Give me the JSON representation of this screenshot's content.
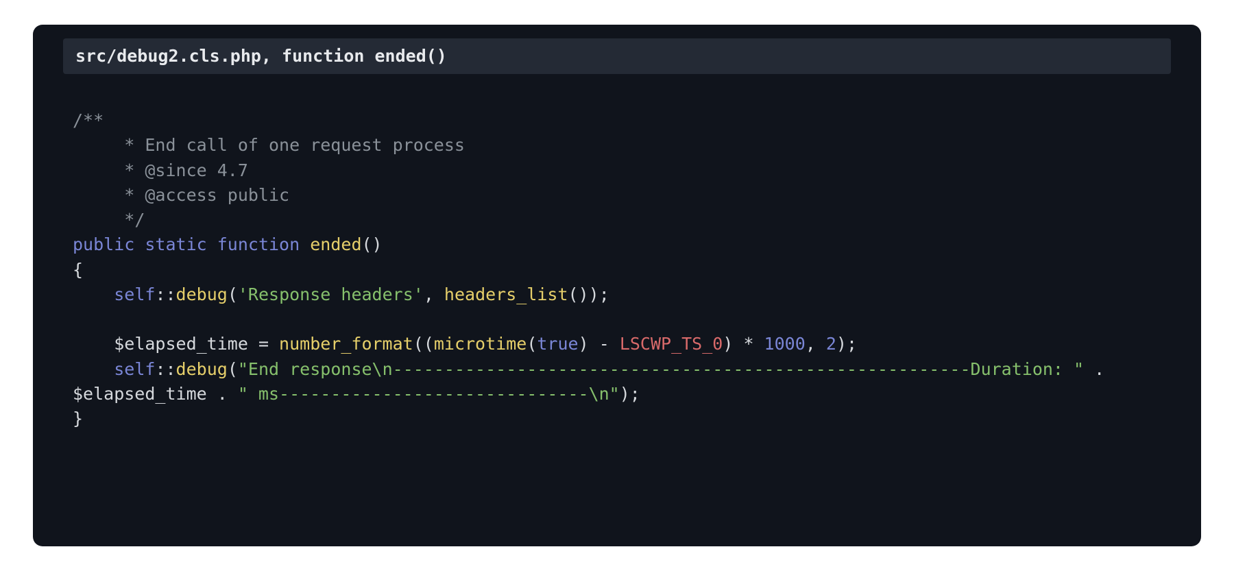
{
  "title": "src/debug2.cls.php, function ended()",
  "code": {
    "comment_open": "/**",
    "comment_l1": "     * End call of one request process",
    "comment_l2": "     * @since 4.7",
    "comment_l3": "     * @access public",
    "comment_close": "     */",
    "kw_public": "public",
    "kw_static": "static",
    "kw_function": "function",
    "fn_name": "ended",
    "paren_pair": "()",
    "brace_open": "{",
    "indent": "    ",
    "self": "self",
    "dcolon": "::",
    "debug": "debug",
    "lparen": "(",
    "rparen": ")",
    "semi": ";",
    "comma_sp": ", ",
    "str_response_headers": "'Response headers'",
    "headers_list": "headers_list",
    "empty_paren": "()",
    "var_elapsed": "$elapsed_time",
    "eq": " = ",
    "number_format": "number_format",
    "microtime": "microtime",
    "true": "true",
    "minus": " - ",
    "const_ts0": "LSCWP_TS_0",
    "rparen2": ")",
    "times": " * ",
    "num_1000": "1000",
    "num_2": "2",
    "str_end_response": "\"End response\\n--------------------------------------------------------Duration: \"",
    "dot": " . ",
    "str_ms_tail": "\" ms------------------------------\\n\"",
    "brace_close": "}"
  }
}
